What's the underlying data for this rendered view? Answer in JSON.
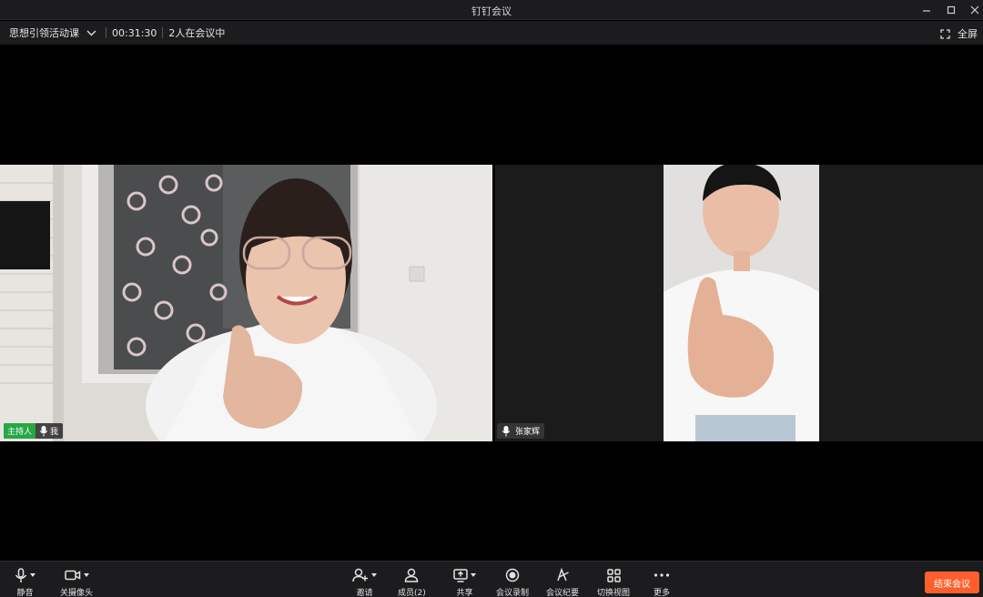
{
  "window": {
    "title": "钉钉会议"
  },
  "infobar": {
    "meeting_name": "思想引领活动课",
    "elapsed": "00:31:30",
    "participants_text": "2人在会议中",
    "fullscreen_label": "全屏"
  },
  "videos": {
    "host": {
      "role_badge": "主持人",
      "name": "我"
    },
    "guest": {
      "name": "张家辉"
    }
  },
  "toolbar": {
    "mute_label": "静音",
    "camera_label": "关摄像头",
    "invite_label": "邀请",
    "members_label": "成员(2)",
    "share_label": "共享",
    "record_label": "会议录制",
    "minutes_label": "会议纪要",
    "view_label": "切换视图",
    "more_label": "更多",
    "end_label": "结束会议"
  },
  "colors": {
    "accent_end": "#ff5f2d",
    "host_badge": "#27a745",
    "bar_bg": "#1c1c1e"
  }
}
